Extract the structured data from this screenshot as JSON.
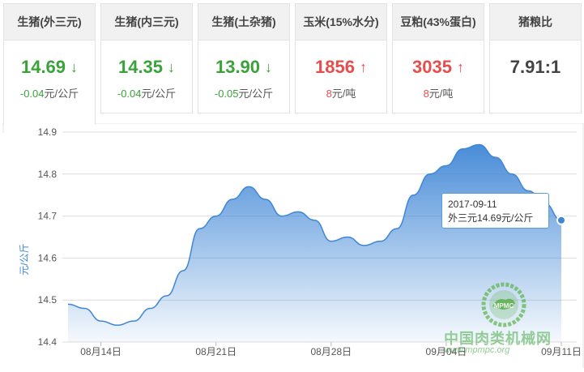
{
  "cards": [
    {
      "label": "生猪(外三元)",
      "value": "14.69",
      "direction": "down",
      "arrow": "↓",
      "change_num": "-0.04",
      "unit": "元/公斤"
    },
    {
      "label": "生猪(内三元)",
      "value": "14.35",
      "direction": "down",
      "arrow": "↓",
      "change_num": "-0.04",
      "unit": "元/公斤"
    },
    {
      "label": "生猪(土杂猪)",
      "value": "13.90",
      "direction": "down",
      "arrow": "↓",
      "change_num": "-0.05",
      "unit": "元/公斤"
    },
    {
      "label": "玉米(15%水分)",
      "value": "1856",
      "direction": "up",
      "arrow": "↑",
      "change_num": "8",
      "unit": "元/吨"
    },
    {
      "label": "豆粕(43%蛋白)",
      "value": "3035",
      "direction": "up",
      "arrow": "↑",
      "change_num": "8",
      "unit": "元/吨"
    },
    {
      "label": "猪粮比",
      "value": "7.91:1",
      "direction": "neutral",
      "arrow": "",
      "change_num": "",
      "unit": ""
    }
  ],
  "colors": {
    "down": "#3aa23a",
    "up": "#e84d4d",
    "line": "#3f86d6",
    "area_top": "#3f86d6"
  },
  "chart_data": {
    "type": "area",
    "ylabel": "元/公斤",
    "ylim": [
      14.4,
      14.9
    ],
    "yticks": [
      "14.9",
      "14.8",
      "14.7",
      "14.6",
      "14.5",
      "14.4"
    ],
    "xtick_labels": [
      "08月14日",
      "08月21日",
      "08月28日",
      "09月04日",
      "09月11日"
    ],
    "x": [
      "08-12",
      "08-13",
      "08-14",
      "08-15",
      "08-16",
      "08-17",
      "08-18",
      "08-19",
      "08-20",
      "08-21",
      "08-22",
      "08-23",
      "08-24",
      "08-25",
      "08-26",
      "08-27",
      "08-28",
      "08-29",
      "08-30",
      "08-31",
      "09-01",
      "09-02",
      "09-03",
      "09-04",
      "09-05",
      "09-06",
      "09-07",
      "09-08",
      "09-09",
      "09-10",
      "09-11"
    ],
    "series": [
      {
        "values": [
          14.49,
          14.48,
          14.45,
          14.44,
          14.45,
          14.48,
          14.51,
          14.57,
          14.67,
          14.7,
          14.74,
          14.77,
          14.74,
          14.7,
          14.71,
          14.69,
          14.64,
          14.65,
          14.63,
          14.64,
          14.67,
          14.75,
          14.8,
          14.82,
          14.86,
          14.87,
          14.84,
          14.8,
          14.76,
          14.73,
          14.69
        ]
      }
    ],
    "tooltip": {
      "date": "2017-09-11",
      "text": "外三元14.69元/公斤"
    }
  },
  "watermark": {
    "name": "中国肉类机械网",
    "url": "www.mpmpc.org",
    "logo_text": "MPMC"
  }
}
